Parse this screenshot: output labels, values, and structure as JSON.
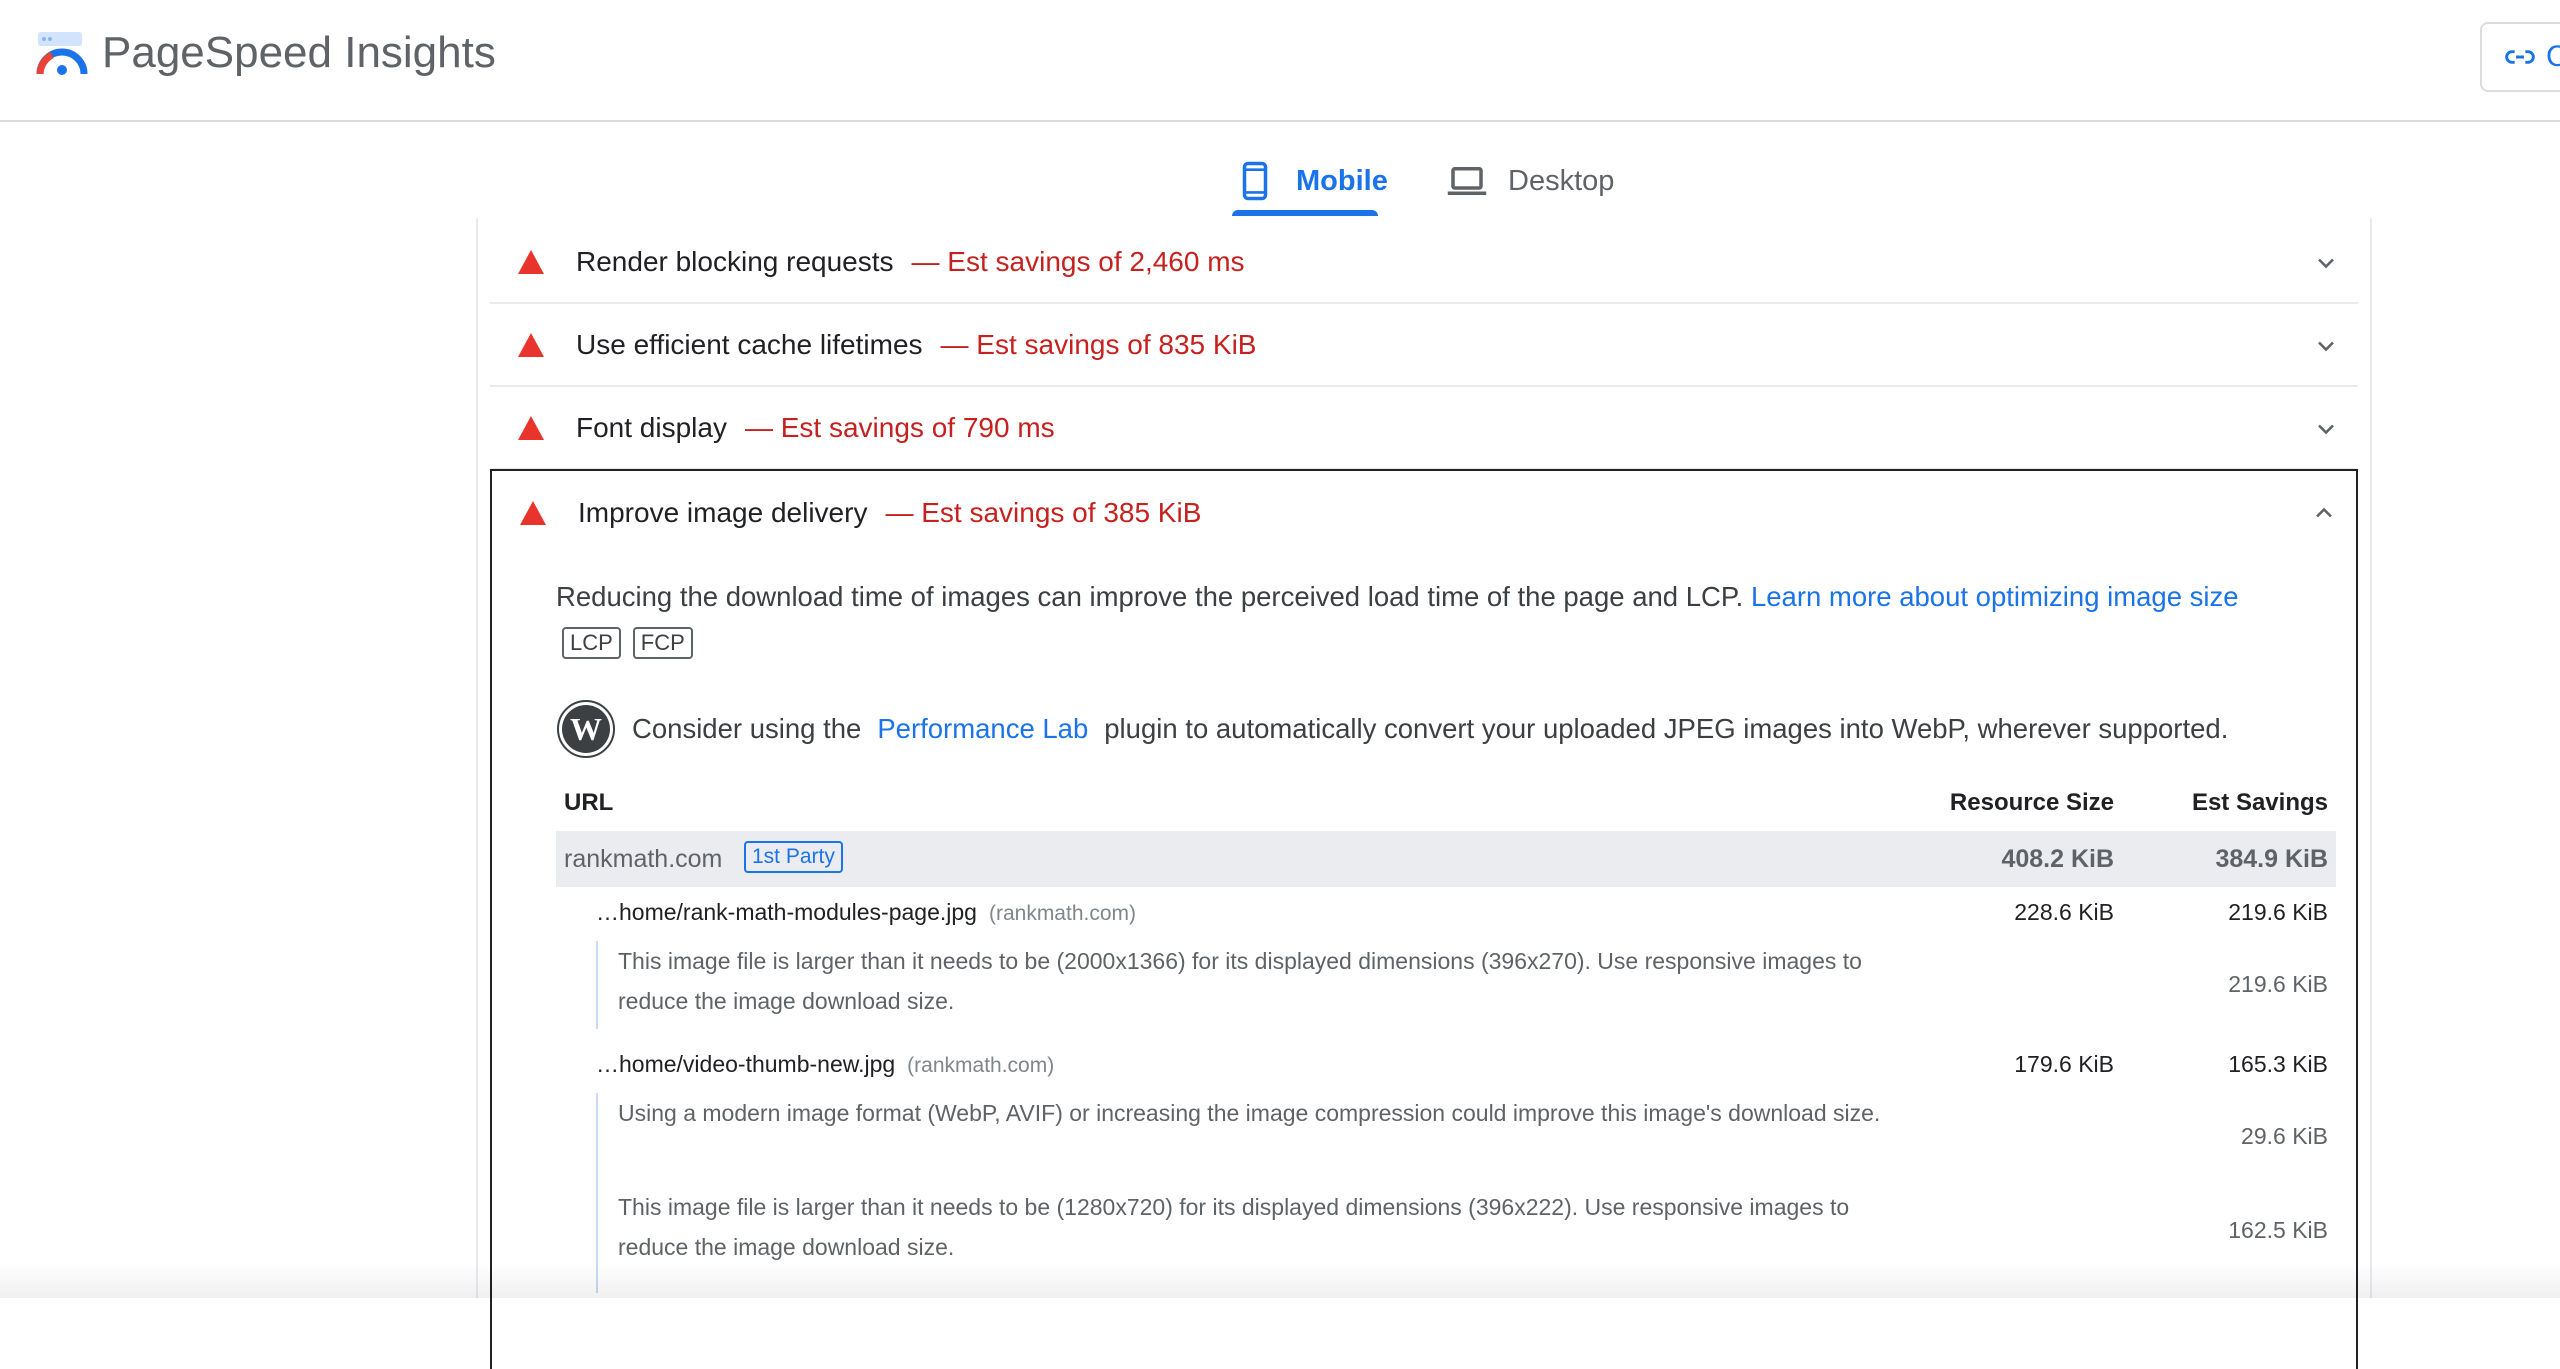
{
  "header": {
    "title": "PageSpeed Insights",
    "copy_link_label": "C"
  },
  "tabs": [
    {
      "label": "Mobile",
      "active": true
    },
    {
      "label": "Desktop",
      "active": false
    }
  ],
  "audits": [
    {
      "title": "Render blocking requests",
      "savings": "— Est savings of 2,460 ms"
    },
    {
      "title": "Use efficient cache lifetimes",
      "savings": "— Est savings of 835 KiB"
    },
    {
      "title": "Font display",
      "savings": "— Est savings of 790 ms"
    }
  ],
  "expanded_audit": {
    "title": "Improve image delivery",
    "savings": "— Est savings of 385 KiB",
    "description": "Reducing the download time of images can improve the perceived load time of the page and LCP.",
    "learn_more": "Learn more about optimizing image size",
    "metric_tags": [
      "LCP",
      "FCP"
    ],
    "stack_pack": {
      "prefix": "Consider using the",
      "link": "Performance Lab",
      "suffix": "plugin to automatically convert your uploaded JPEG images into WebP, wherever supported."
    },
    "table": {
      "headers": {
        "url": "URL",
        "size": "Resource Size",
        "savings": "Est Savings"
      },
      "entity": {
        "name": "rankmath.com",
        "badge": "1st Party",
        "size": "408.2 KiB",
        "savings": "384.9 KiB"
      },
      "items": [
        {
          "url": "…home/rank-math-modules-page.jpg",
          "host": "(rankmath.com)",
          "size": "228.6 KiB",
          "savings": "219.6 KiB",
          "subitems": [
            {
              "text": "This image file is larger than it needs to be (2000x1366) for its displayed dimensions (396x270). Use responsive images to reduce the image download size.",
              "savings": "219.6 KiB"
            }
          ]
        },
        {
          "url": "…home/video-thumb-new.jpg",
          "host": "(rankmath.com)",
          "size": "179.6 KiB",
          "savings": "165.3 KiB",
          "subitems": [
            {
              "text": "Using a modern image format (WebP, AVIF) or increasing the image compression could improve this image's download size.",
              "savings": "29.6 KiB"
            },
            {
              "text": "This image file is larger than it needs to be (1280x720) for its displayed dimensions (396x222). Use responsive images to reduce the image download size.",
              "savings": "162.5 KiB"
            }
          ]
        }
      ]
    }
  },
  "colors": {
    "accent": "#1a73e8",
    "warning": "#c5221f",
    "warning_icon": "#e8342c"
  },
  "icons": [
    "pagespeed-logo-icon",
    "link-icon",
    "mobile-phone-icon",
    "laptop-icon",
    "warning-triangle-icon",
    "chevron-down-icon",
    "chevron-up-icon",
    "wordpress-icon"
  ]
}
